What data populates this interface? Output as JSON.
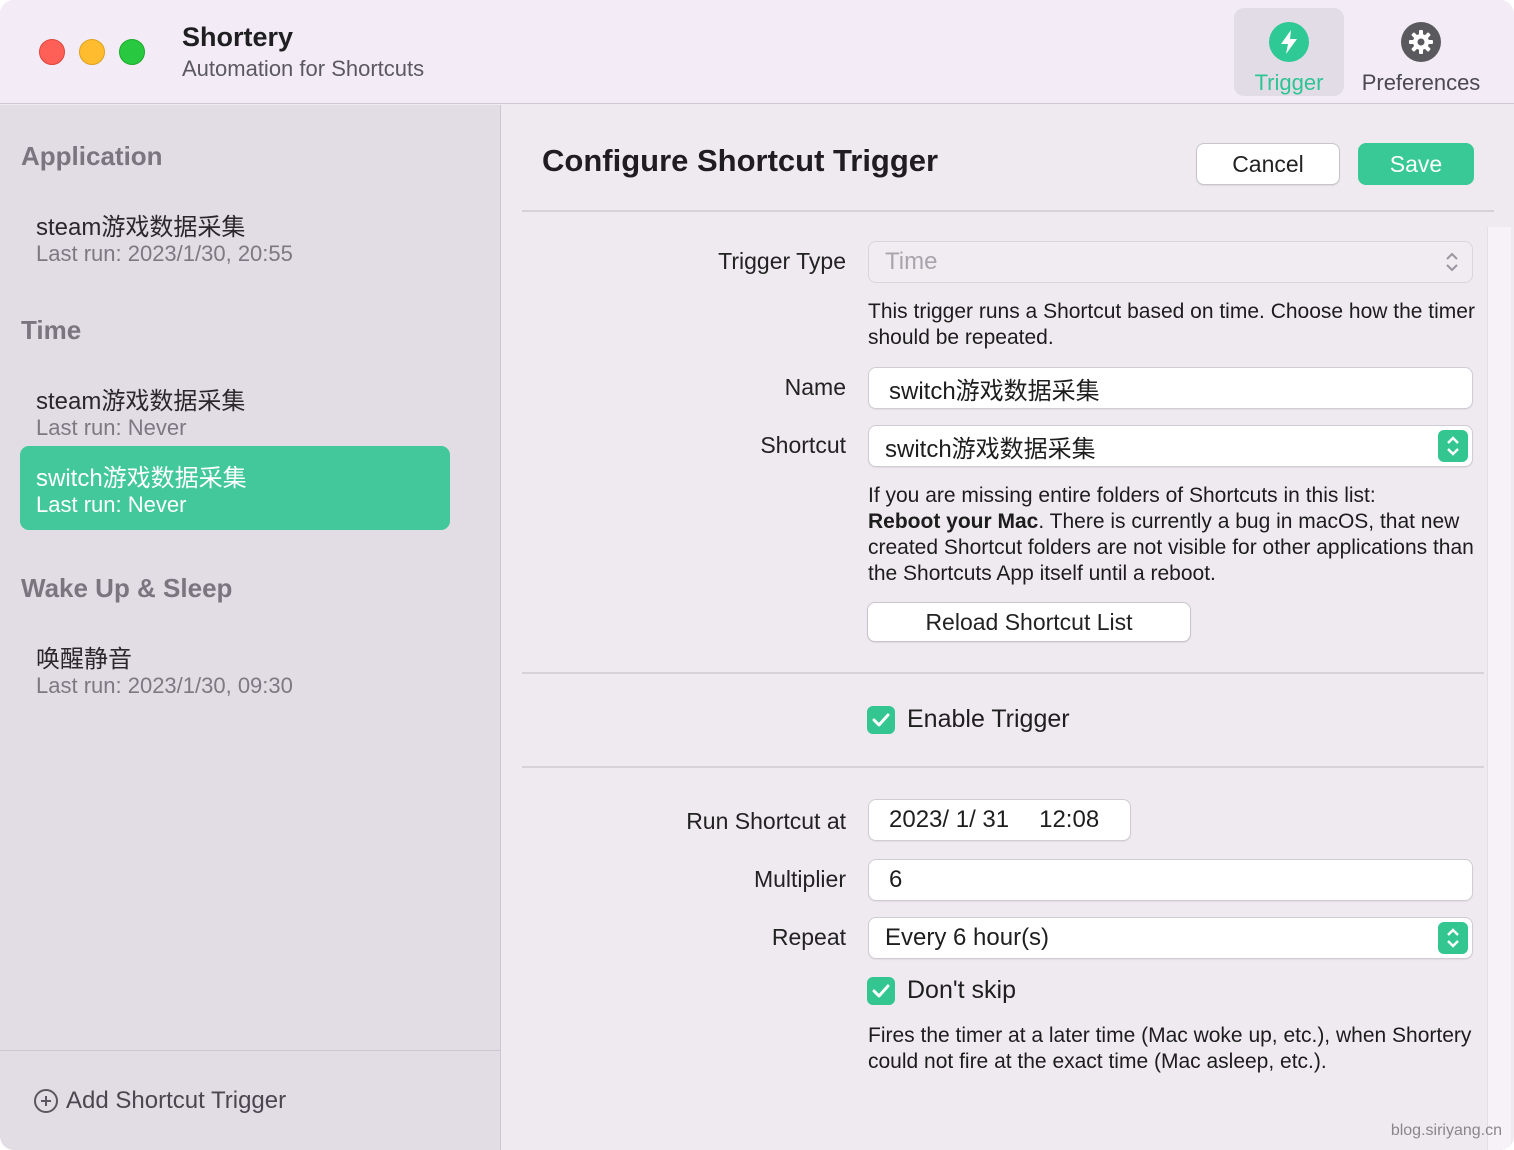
{
  "app": {
    "title": "Shortery",
    "subtitle": "Automation for Shortcuts"
  },
  "toolbar": {
    "trigger_label": "Trigger",
    "preferences_label": "Preferences"
  },
  "sidebar": {
    "sections": [
      {
        "heading": "Application",
        "items": [
          {
            "name": "steam游戏数据采集",
            "last_run": "Last run: 2023/1/30, 20:55"
          }
        ]
      },
      {
        "heading": "Time",
        "items": [
          {
            "name": "steam游戏数据采集",
            "last_run": "Last run: Never"
          },
          {
            "name": "switch游戏数据采集",
            "last_run": "Last run: Never",
            "selected": true
          }
        ]
      },
      {
        "heading": "Wake Up & Sleep",
        "items": [
          {
            "name": "唤醒静音",
            "last_run": "Last run: 2023/1/30, 09:30"
          }
        ]
      }
    ],
    "add_label": "Add Shortcut Trigger"
  },
  "main": {
    "title": "Configure Shortcut Trigger",
    "cancel_label": "Cancel",
    "save_label": "Save",
    "trigger_type": {
      "label": "Trigger Type",
      "value": "Time"
    },
    "trigger_type_help": "This trigger runs a Shortcut based on time. Choose how the timer should be repeated.",
    "name": {
      "label": "Name",
      "value": "switch游戏数据采集"
    },
    "shortcut": {
      "label": "Shortcut",
      "value": "switch游戏数据采集"
    },
    "shortcut_help": {
      "line1": "If you are missing entire folders of Shortcuts in this list:",
      "bold": "Reboot your Mac",
      "rest": ". There is currently a bug in macOS, that new created Shortcut folders are not visible for other applications than the Shortcuts App itself until a reboot."
    },
    "reload_label": "Reload Shortcut List",
    "enable_trigger": {
      "label": "Enable Trigger",
      "checked": true
    },
    "run_at": {
      "label": "Run Shortcut at",
      "date": "2023/  1/ 31",
      "time": "12:08"
    },
    "multiplier": {
      "label": "Multiplier",
      "value": "6"
    },
    "repeat": {
      "label": "Repeat",
      "value": "Every 6 hour(s)"
    },
    "dont_skip": {
      "label": "Don't skip",
      "checked": true
    },
    "dont_skip_help": "Fires the timer at a later time (Mac woke up, etc.), when Shortery could not fire at the exact time (Mac asleep, etc.)."
  },
  "watermark": "blog.siriyang.cn",
  "colors": {
    "accent": "#38c996",
    "selected_row": "#42c89a"
  }
}
